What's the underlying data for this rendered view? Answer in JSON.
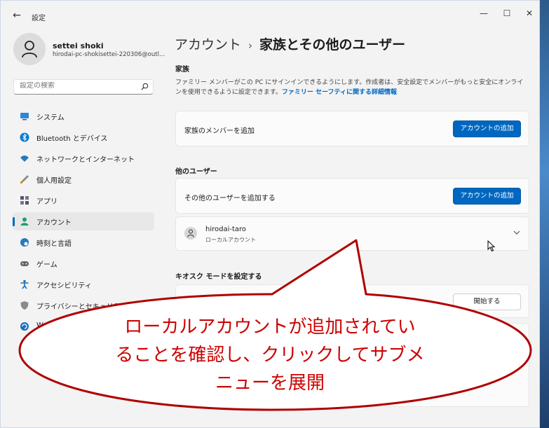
{
  "window": {
    "title": "設定",
    "back_glyph": "←",
    "min_glyph": "—",
    "max_glyph": "☐",
    "close_glyph": "✕"
  },
  "profile": {
    "name": "settei shoki",
    "email": "hirodai-pc-shokisettei-220306@outl..."
  },
  "search": {
    "placeholder": "設定の検索",
    "icon": "search-icon"
  },
  "sidebar": {
    "items": [
      {
        "label": "システム",
        "icon": "monitor-icon",
        "color": "#0078d4"
      },
      {
        "label": "Bluetooth とデバイス",
        "icon": "bluetooth-icon",
        "color": "#0078d4"
      },
      {
        "label": "ネットワークとインターネット",
        "icon": "wifi-icon",
        "color": "#2a7ab8"
      },
      {
        "label": "個人用設定",
        "icon": "brush-icon",
        "color": "#c07a30"
      },
      {
        "label": "アプリ",
        "icon": "apps-icon",
        "color": "#556"
      },
      {
        "label": "アカウント",
        "icon": "account-icon",
        "color": "#1aa36b"
      },
      {
        "label": "時刻と言語",
        "icon": "globe-clock-icon",
        "color": "#2a7ab8"
      },
      {
        "label": "ゲーム",
        "icon": "gamepad-icon",
        "color": "#666"
      },
      {
        "label": "アクセシビリティ",
        "icon": "accessibility-icon",
        "color": "#1a6fbf"
      },
      {
        "label": "プライバシーとセキュリティ",
        "icon": "shield-icon",
        "color": "#777"
      },
      {
        "label": "W",
        "icon": "update-icon",
        "color": "#1a6fbf"
      }
    ],
    "active_index": 5
  },
  "breadcrumb": {
    "parent": "アカウント",
    "separator": "›",
    "current": "家族とその他のユーザー"
  },
  "family": {
    "heading": "家族",
    "description": "ファミリー メンバーがこの PC にサインインできるようにします。作成者は、安全設定でメンバーがもっと安全にオンラインを使用できるように設定できます。",
    "link_text": "ファミリー セーフティに関する詳細情報",
    "card_label": "家族のメンバーを追加",
    "button_label": "アカウントの追加"
  },
  "other_users": {
    "heading": "他のユーザー",
    "card_label": "その他のユーザーを追加する",
    "button_label": "アカウントの追加",
    "user": {
      "name": "hirodai-taro",
      "type": "ローカルアカウント"
    }
  },
  "kiosk": {
    "heading": "キオスク モードを設定する",
    "button_label": "開始する"
  },
  "callout": {
    "line1": "ローカルアカウントが追加されてい",
    "line2": "ることを確認し、クリックしてサブメ",
    "line3": "ニューを展開",
    "stroke_color": "#b00000",
    "text_color": "#cc0000"
  }
}
